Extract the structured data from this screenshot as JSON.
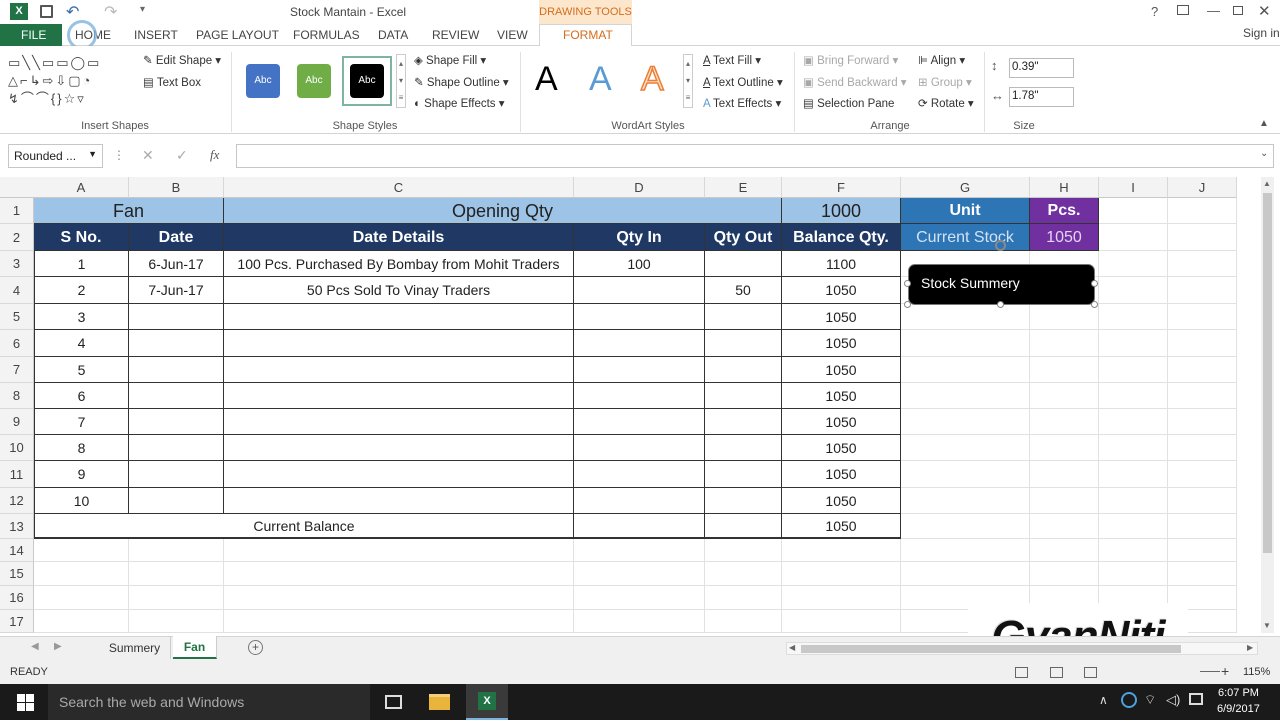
{
  "window": {
    "title": "Stock Mantain - Excel",
    "contextual_title": "DRAWING TOOLS",
    "sign_in": "Sign in"
  },
  "ribbon_tabs": [
    "FILE",
    "HOME",
    "INSERT",
    "PAGE LAYOUT",
    "FORMULAS",
    "DATA",
    "REVIEW",
    "VIEW",
    "FORMAT"
  ],
  "ribbon": {
    "insert_shapes": {
      "label": "Insert Shapes",
      "edit_shape": "Edit Shape",
      "text_box": "Text Box"
    },
    "shape_styles": {
      "label": "Shape Styles",
      "style1": "Abc",
      "style2": "Abc",
      "style3": "Abc",
      "fill": "Shape Fill",
      "outline": "Shape Outline",
      "effects": "Shape Effects"
    },
    "wordart": {
      "label": "WordArt Styles",
      "sample": "A",
      "text_fill": "Text Fill",
      "text_outline": "Text Outline",
      "text_effects": "Text Effects"
    },
    "arrange": {
      "label": "Arrange",
      "bring_forward": "Bring Forward",
      "send_backward": "Send Backward",
      "selection_pane": "Selection Pane",
      "align": "Align",
      "group": "Group",
      "rotate": "Rotate"
    },
    "size": {
      "label": "Size",
      "height": "0.39\"",
      "width": "1.78\""
    }
  },
  "formula_bar": {
    "name_box": "Rounded ...",
    "cancel": "✕",
    "enter": "✓",
    "fx": "fx",
    "value": ""
  },
  "columns": [
    "A",
    "B",
    "C",
    "D",
    "E",
    "F",
    "G",
    "H",
    "I",
    "J"
  ],
  "rows": [
    "1",
    "2",
    "3",
    "4",
    "5",
    "6",
    "7",
    "8",
    "9",
    "10",
    "11",
    "12",
    "13",
    "14",
    "15",
    "16",
    "17"
  ],
  "sheet": {
    "title_row": {
      "a": "Fan",
      "c": "Opening Qty",
      "f": "1000",
      "g": "Unit",
      "h": "Pcs."
    },
    "headers": {
      "a": "S No.",
      "b": "Date",
      "c": "Date Details",
      "d": "Qty In",
      "e": "Qty Out",
      "f": "Balance Qty.",
      "g": "Current Stock",
      "h": "1050"
    },
    "data": [
      {
        "sno": "1",
        "date": "6-Jun-17",
        "details": "100 Pcs. Purchased By Bombay from Mohit Traders",
        "qin": "100",
        "qout": "",
        "bal": "1100"
      },
      {
        "sno": "2",
        "date": "7-Jun-17",
        "details": "50 Pcs Sold To Vinay Traders",
        "qin": "",
        "qout": "50",
        "bal": "1050"
      },
      {
        "sno": "3",
        "date": "",
        "details": "",
        "qin": "",
        "qout": "",
        "bal": "1050"
      },
      {
        "sno": "4",
        "date": "",
        "details": "",
        "qin": "",
        "qout": "",
        "bal": "1050"
      },
      {
        "sno": "5",
        "date": "",
        "details": "",
        "qin": "",
        "qout": "",
        "bal": "1050"
      },
      {
        "sno": "6",
        "date": "",
        "details": "",
        "qin": "",
        "qout": "",
        "bal": "1050"
      },
      {
        "sno": "7",
        "date": "",
        "details": "",
        "qin": "",
        "qout": "",
        "bal": "1050"
      },
      {
        "sno": "8",
        "date": "",
        "details": "",
        "qin": "",
        "qout": "",
        "bal": "1050"
      },
      {
        "sno": "9",
        "date": "",
        "details": "",
        "qin": "",
        "qout": "",
        "bal": "1050"
      },
      {
        "sno": "10",
        "date": "",
        "details": "",
        "qin": "",
        "qout": "",
        "bal": "1050"
      }
    ],
    "total": {
      "label": "Current Balance",
      "bal": "1050"
    },
    "shape_text": "Stock Summery"
  },
  "sheet_tabs": [
    "Summery",
    "Fan"
  ],
  "status": {
    "ready": "READY",
    "zoom": "115%"
  },
  "watermark": "GyanNitj",
  "taskbar": {
    "search": "Search the web and Windows",
    "time": "6:07 PM",
    "date": "6/9/2017"
  },
  "colors": {
    "header_blue": "#1f3864",
    "light_blue": "#9dc3e6",
    "unit_blue": "#2e75b6",
    "purple": "#7030a0",
    "excel_green": "#217346",
    "format_orange": "#d46d1e"
  }
}
